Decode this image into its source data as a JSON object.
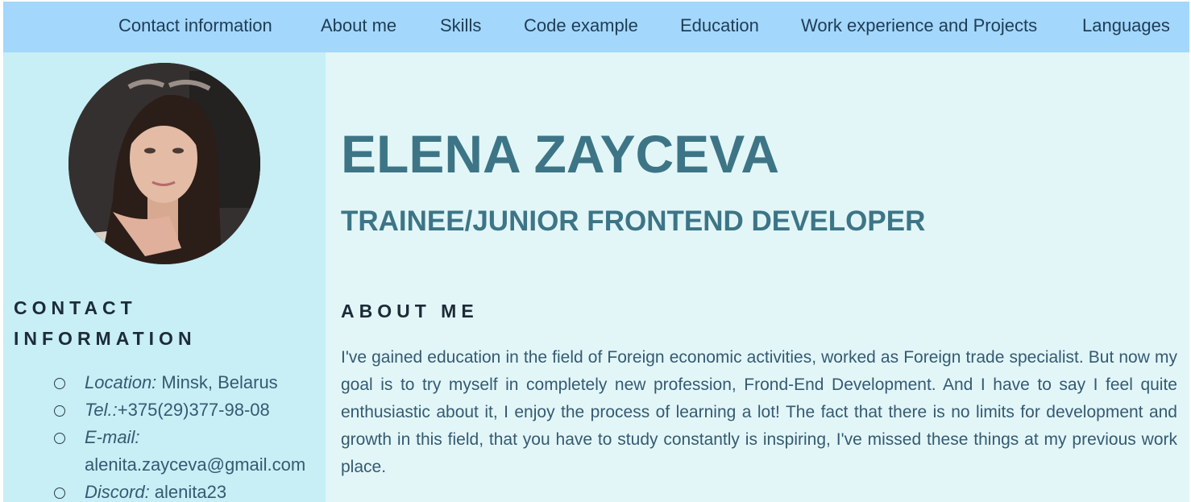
{
  "nav": {
    "items": [
      {
        "label": "Contact information"
      },
      {
        "label": "About me"
      },
      {
        "label": "Skills"
      },
      {
        "label": "Code example"
      },
      {
        "label": "Education"
      },
      {
        "label": "Work experience and Projects"
      },
      {
        "label": "Languages"
      }
    ]
  },
  "profile": {
    "name": "ELENA ZAYCEVA",
    "role": "TRAINEE/JUNIOR FRONTEND DEVELOPER",
    "photo_icon": "avatar-photo"
  },
  "contact": {
    "heading": "CONTACT INFORMATION",
    "items": [
      {
        "key": "Location:",
        "value": " Minsk, Belarus"
      },
      {
        "key": "Tel.:",
        "value": "+375(29)377-98-08"
      },
      {
        "key": "E-mail:",
        "value": "alenita.zayceva@gmail.com"
      },
      {
        "key": "Discord:",
        "value": " alenita23"
      }
    ]
  },
  "about": {
    "heading": "ABOUT ME",
    "text": "I've gained education in the field of Foreign economic activities, worked as Foreign trade specialist. But now my goal is to try myself in completely new profession, Frond-End Development. And I have to say I feel quite enthusiastic about it, I enjoy the process of learning a lot! The fact that there is no limits for development and growth in this field, that you have to study constantly is inspiring, I've missed these things at my previous work place."
  },
  "colors": {
    "nav_bg": "#a3d7fb",
    "sidebar_bg": "#c7eff5",
    "main_bg": "#e2f6f8",
    "accent": "#3d7586"
  }
}
